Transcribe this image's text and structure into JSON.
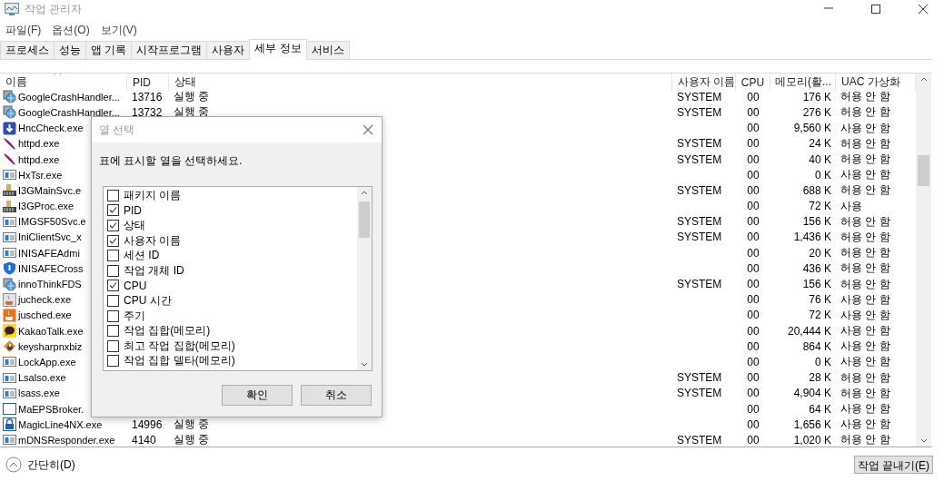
{
  "window": {
    "title": "작업 관리자"
  },
  "menu": [
    "파일(F)",
    "옵션(O)",
    "보기(V)"
  ],
  "tabs": [
    {
      "label": "프로세스",
      "selected": false
    },
    {
      "label": "성능",
      "selected": false
    },
    {
      "label": "앱 기록",
      "selected": false
    },
    {
      "label": "시작프로그램",
      "selected": false
    },
    {
      "label": "사용자",
      "selected": false
    },
    {
      "label": "세부 정보",
      "selected": true
    },
    {
      "label": "서비스",
      "selected": false
    }
  ],
  "table": {
    "columns": [
      "이름",
      "PID",
      "상태",
      "사용자 이름",
      "CPU",
      "메모리(활...",
      "UAC 가상화"
    ],
    "rows": [
      {
        "kind": "globe",
        "name": "GoogleCrashHandler...",
        "pid": "13716",
        "status": "실행 중",
        "user": "SYSTEM",
        "cpu": "00",
        "memory": "176 K",
        "uac": "허용 안 함"
      },
      {
        "kind": "globe",
        "name": "GoogleCrashHandler...",
        "pid": "13732",
        "status": "실행 중",
        "user": "SYSTEM",
        "cpu": "00",
        "memory": "276 K",
        "uac": "허용 안 함"
      },
      {
        "kind": "download",
        "name": "HncCheck.exe",
        "cpu": "00",
        "memory": "9,560 K",
        "uac": "사용 안 함"
      },
      {
        "kind": "feather",
        "name": "httpd.exe",
        "user": "SYSTEM",
        "cpu": "00",
        "memory": "24 K",
        "uac": "허용 안 함"
      },
      {
        "kind": "feather",
        "name": "httpd.exe",
        "user": "SYSTEM",
        "cpu": "00",
        "memory": "40 K",
        "uac": "허용 안 함"
      },
      {
        "kind": "window",
        "name": "HxTsr.exe",
        "cpu": "00",
        "memory": "0 K",
        "uac": "사용 안 함"
      },
      {
        "kind": "building",
        "name": "I3GMainSvc.e",
        "user": "SYSTEM",
        "cpu": "00",
        "memory": "688 K",
        "uac": "허용 안 함"
      },
      {
        "kind": "building",
        "name": "I3GProc.exe",
        "cpu": "00",
        "memory": "72 K",
        "uac": "사용"
      },
      {
        "kind": "window",
        "name": "IMGSF50Svc.e",
        "user": "SYSTEM",
        "cpu": "00",
        "memory": "156 K",
        "uac": "허용 안 함"
      },
      {
        "kind": "window",
        "name": "IniClientSvc_x",
        "user": "SYSTEM",
        "cpu": "00",
        "memory": "1,436 K",
        "uac": "허용 안 함"
      },
      {
        "kind": "window",
        "name": "INISAFEAdmi",
        "cpu": "00",
        "memory": "20 K",
        "uac": "허용 안 함"
      },
      {
        "kind": "shield",
        "name": "INISAFECross",
        "cpu": "00",
        "memory": "436 K",
        "uac": "허용 안 함"
      },
      {
        "kind": "globe",
        "name": "innoThinkFDS",
        "user": "SYSTEM",
        "cpu": "00",
        "memory": "156 K",
        "uac": "허용 안 함"
      },
      {
        "kind": "cup-grey",
        "name": "jucheck.exe",
        "cpu": "00",
        "memory": "76 K",
        "uac": "사용 안 함"
      },
      {
        "kind": "cup-orange",
        "name": "jusched.exe",
        "cpu": "00",
        "memory": "72 K",
        "uac": "사용 안 함"
      },
      {
        "kind": "speech",
        "name": "KakaoTalk.exe",
        "cpu": "00",
        "memory": "20,444 K",
        "uac": "사용 안 함"
      },
      {
        "kind": "key",
        "name": "keysharpnxbiz",
        "cpu": "00",
        "memory": "864 K",
        "uac": "사용 안 함"
      },
      {
        "kind": "window",
        "name": "LockApp.exe",
        "cpu": "00",
        "memory": "0 K",
        "uac": "사용 안 함"
      },
      {
        "kind": "window",
        "name": "Lsalso.exe",
        "user": "SYSTEM",
        "cpu": "00",
        "memory": "28 K",
        "uac": "허용 안 함"
      },
      {
        "kind": "window",
        "name": "lsass.exe",
        "user": "SYSTEM",
        "cpu": "00",
        "memory": "4,904 K",
        "uac": "허용 안 함"
      },
      {
        "kind": "blank",
        "name": "MaEPSBroker.",
        "cpu": "00",
        "memory": "64 K",
        "uac": "사용 안 함"
      },
      {
        "kind": "lock",
        "name": "MagicLine4NX.exe",
        "pid": "14996",
        "status": "실행 중",
        "cpu": "00",
        "memory": "1,656 K",
        "uac": "사용 안 함"
      },
      {
        "kind": "window",
        "name": "mDNSResponder.exe",
        "pid": "4140",
        "status": "실행 중",
        "user": "SYSTEM",
        "cpu": "00",
        "memory": "1,020 K",
        "uac": "허용 안 함"
      }
    ]
  },
  "dialog": {
    "title": "열 선택",
    "prompt": "표에 표시할 열을 선택하세요.",
    "options": [
      {
        "label": "패키지 이름",
        "checked": false
      },
      {
        "label": "PID",
        "checked": true
      },
      {
        "label": "상태",
        "checked": true
      },
      {
        "label": "사용자 이름",
        "checked": true
      },
      {
        "label": "세션 ID",
        "checked": false
      },
      {
        "label": "작업 개체 ID",
        "checked": false
      },
      {
        "label": "CPU",
        "checked": true
      },
      {
        "label": "CPU 시간",
        "checked": false
      },
      {
        "label": "주기",
        "checked": false
      },
      {
        "label": "작업 집합(메모리)",
        "checked": false
      },
      {
        "label": "최고 작업 집합(메모리)",
        "checked": false
      },
      {
        "label": "작업 집합 델타(메모리)",
        "checked": false
      }
    ],
    "buttons": [
      "확인",
      "취소"
    ]
  },
  "footer": {
    "collapse": "간단히(D)",
    "end_task": "작업 끝내기(E)"
  }
}
